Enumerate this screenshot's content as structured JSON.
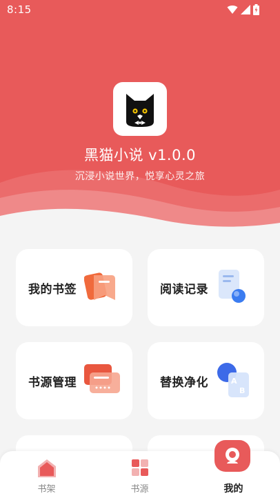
{
  "status_bar": {
    "time": "8:15"
  },
  "app": {
    "title": "黑猫小说 v1.0.0",
    "slogan": "沉浸小说世界，悦享心灵之旅"
  },
  "menu": [
    {
      "label": "我的书签",
      "icon": "bookmark-cards-icon"
    },
    {
      "label": "阅读记录",
      "icon": "document-history-icon"
    },
    {
      "label": "书源管理",
      "icon": "source-cards-icon"
    },
    {
      "label": "替换净化",
      "icon": "replace-ab-icon"
    }
  ],
  "bottom_nav": [
    {
      "label": "书架",
      "icon": "bookshelf-icon"
    },
    {
      "label": "书源",
      "icon": "source-grid-icon"
    },
    {
      "label": "我的",
      "icon": "profile-icon",
      "active": true
    }
  ],
  "colors": {
    "header": "#e85a5a",
    "background": "#f4f4f4",
    "card": "#ffffff",
    "accent": "#e85a5a"
  }
}
